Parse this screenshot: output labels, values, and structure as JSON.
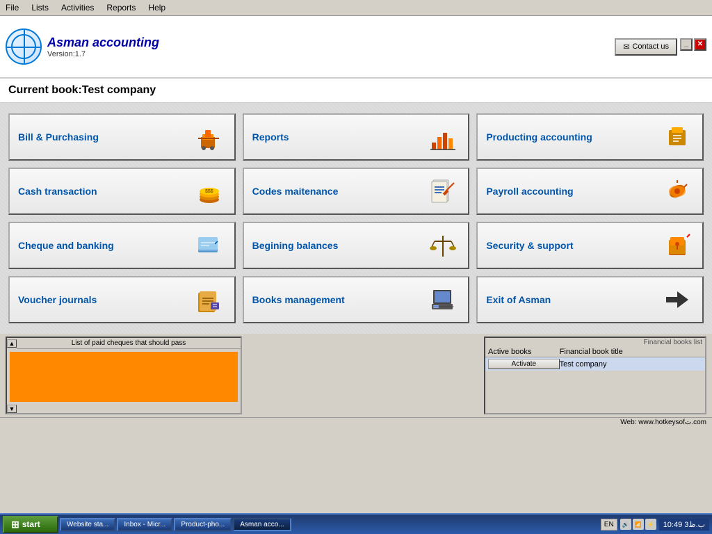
{
  "app": {
    "title": "Asman accounting",
    "version": "Version:1.7",
    "contact_btn": "Contact us",
    "current_book_label": "Current book:Test company"
  },
  "menu": {
    "items": [
      "File",
      "Lists",
      "Activities",
      "Reports",
      "Help"
    ]
  },
  "modules": [
    {
      "id": "bill",
      "label": "Bill & Purchasing",
      "icon": "🛒",
      "col": 1,
      "row": 1
    },
    {
      "id": "reports",
      "label": "Reports",
      "icon": "📊",
      "col": 2,
      "row": 1
    },
    {
      "id": "producting",
      "label": "Producting accounting",
      "icon": "📦",
      "col": 3,
      "row": 1
    },
    {
      "id": "cash",
      "label": "Cash transaction",
      "icon": "💰",
      "col": 1,
      "row": 2
    },
    {
      "id": "codes",
      "label": "Codes maitenance",
      "icon": "📋",
      "col": 2,
      "row": 2
    },
    {
      "id": "payroll",
      "label": "Payroll accounting",
      "icon": "🔧",
      "col": 3,
      "row": 2
    },
    {
      "id": "cheque",
      "label": "Cheque and banking",
      "icon": "💳",
      "col": 1,
      "row": 3
    },
    {
      "id": "balances",
      "label": "Begining balances",
      "icon": "⚖️",
      "col": 2,
      "row": 3
    },
    {
      "id": "security",
      "label": "Security & support",
      "icon": "🔒",
      "col": 3,
      "row": 3
    },
    {
      "id": "voucher",
      "label": "Voucher journals",
      "icon": "📒",
      "col": 1,
      "row": 4
    },
    {
      "id": "books",
      "label": "Books management",
      "icon": "🖥️",
      "col": 2,
      "row": 4
    },
    {
      "id": "exit",
      "label": "Exit of Asman",
      "icon": "◀",
      "col": 3,
      "row": 4
    }
  ],
  "bottom": {
    "left_title": "List of paid cheques that should pass",
    "right_title": "Financial books list",
    "table_headers": [
      "Active books",
      "Financial book title"
    ],
    "table_rows": [
      {
        "active": "Activate",
        "title": "Test company"
      }
    ]
  },
  "taskbar": {
    "start_label": "start",
    "items": [
      {
        "label": "Website sta...",
        "active": false
      },
      {
        "label": "Inbox - Micr...",
        "active": false
      },
      {
        "label": "Product-pho...",
        "active": false
      },
      {
        "label": "Asman acco...",
        "active": true
      }
    ],
    "lang": "EN",
    "time": "10:49 ب.ظ3",
    "website": "Web: www.hotkeysofت.com"
  }
}
